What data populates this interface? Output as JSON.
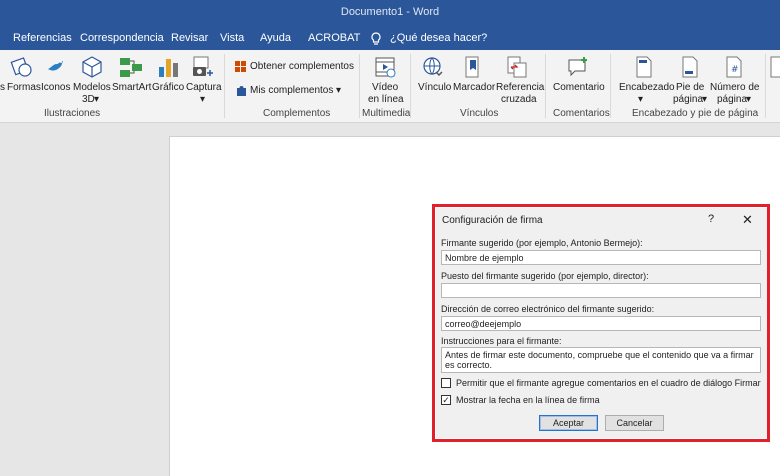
{
  "window": {
    "title": "Documento1  -  Word"
  },
  "menu": {
    "tabs": [
      "Referencias",
      "Correspondencia",
      "Revisar",
      "Vista",
      "Ayuda",
      "ACROBAT"
    ],
    "tell_me": "¿Qué desea hacer?"
  },
  "ribbon": {
    "ilustraciones": {
      "formas_partial": "s",
      "formas": "Formas",
      "iconos": "Iconos",
      "modelos_line1": "Modelos",
      "modelos_line2": "3D",
      "smartart": "SmartArt",
      "grafico": "Gráfico",
      "captura": "Captura",
      "group_label": "Ilustraciones"
    },
    "complementos": {
      "obtener": "Obtener complementos",
      "mis": "Mis complementos",
      "group_label": "Complementos"
    },
    "multimedia": {
      "video_line1": "Vídeo",
      "video_line2": "en línea",
      "group_label": "Multimedia"
    },
    "vinculos": {
      "vinculo": "Vínculo",
      "marcador": "Marcador",
      "referencia_line1": "Referencia",
      "referencia_line2": "cruzada",
      "group_label": "Vínculos"
    },
    "comentarios": {
      "comentario": "Comentario",
      "group_label": "Comentarios"
    },
    "encabezado": {
      "encabezado": "Encabezado",
      "pie_line1": "Pie de",
      "pie_line2": "página",
      "numero_line1": "Número de",
      "numero_line2": "página",
      "group_label": "Encabezado y pie de página"
    },
    "colors": {
      "brand": "#2b579a",
      "dialog_highlight": "#e0202b"
    }
  },
  "dialog": {
    "title": "Configuración de firma",
    "help": "?",
    "close": "✕",
    "firmante_label": "Firmante sugerido (por ejemplo, Antonio Bermejo):",
    "firmante_value": "Nombre de ejemplo",
    "puesto_label": "Puesto del firmante sugerido (por ejemplo, director):",
    "puesto_value": "",
    "correo_label": "Dirección de correo electrónico del firmante sugerido:",
    "correo_value": "correo@deejemplo",
    "instrucciones_label": "Instrucciones para el firmante:",
    "instrucciones_value": "Antes de firmar este documento, compruebe que el contenido que va a firmar es correcto.",
    "permitir_label": "Permitir que el firmante agregue comentarios en el cuadro de diálogo Firmar",
    "permitir_checked": false,
    "mostrar_label": "Mostrar la fecha en la línea de firma",
    "mostrar_checked": true,
    "aceptar": "Aceptar",
    "cancelar": "Cancelar"
  }
}
